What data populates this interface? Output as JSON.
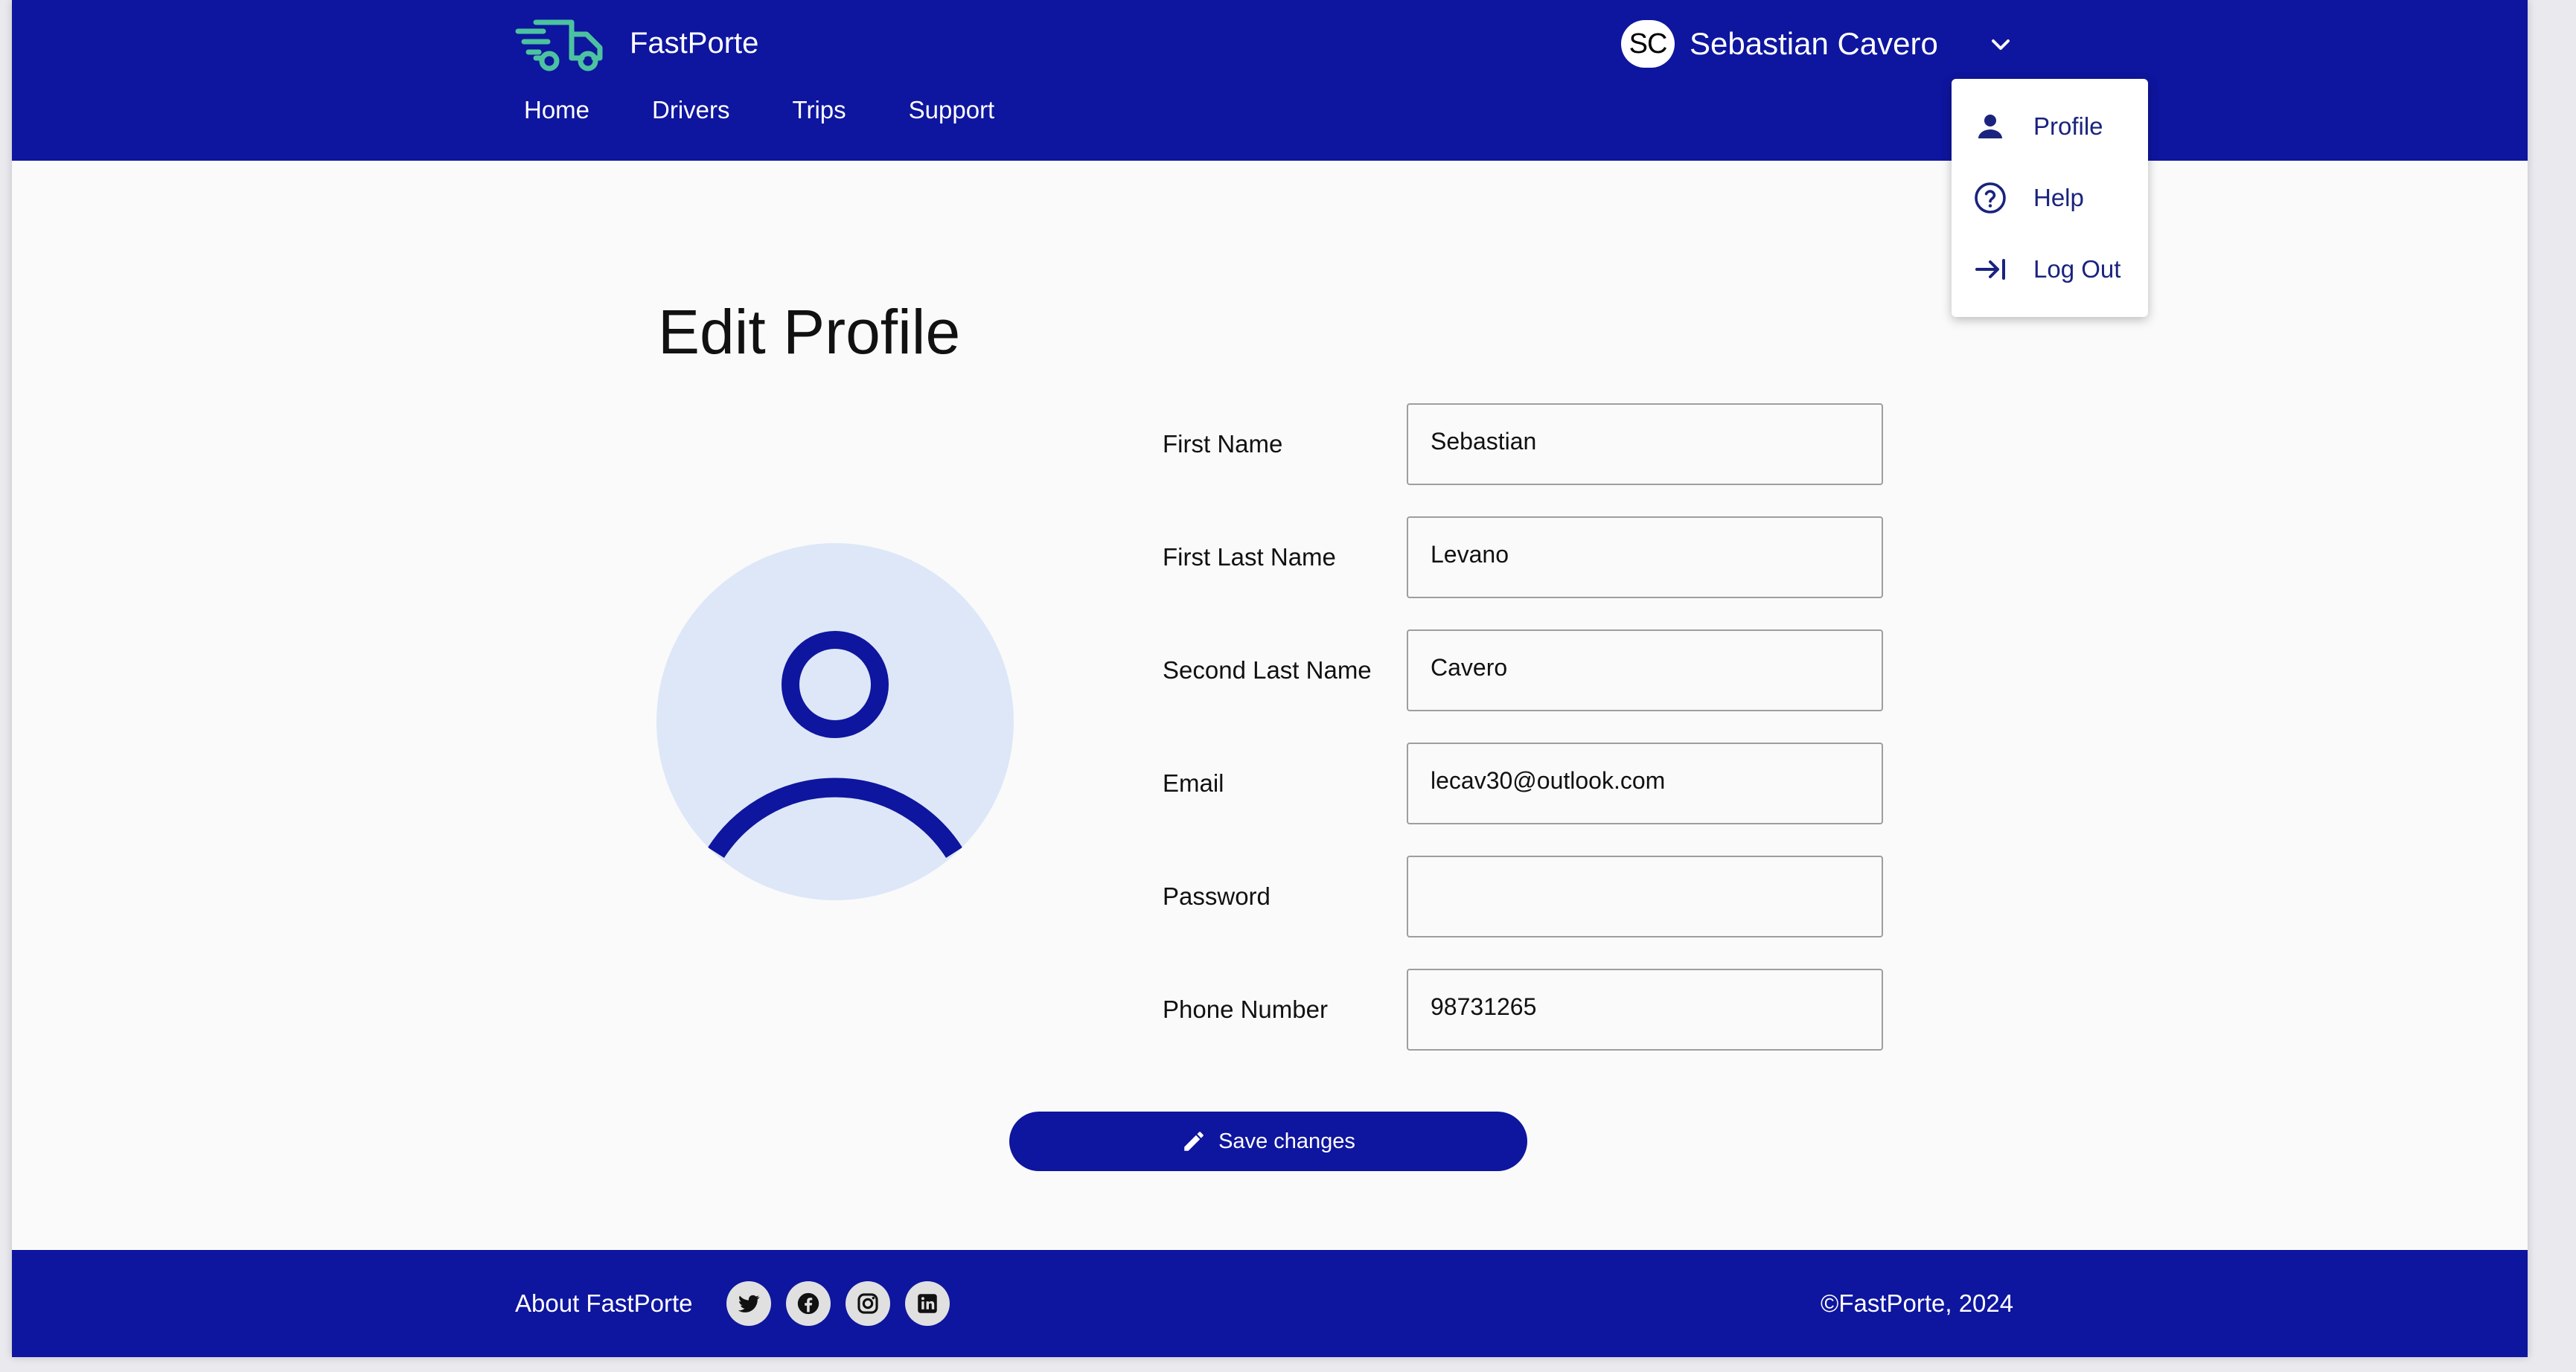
{
  "app": {
    "name": "FastPorte"
  },
  "colors": {
    "primary": "#0e159e",
    "logo_green": "#4cc2a0",
    "avatar_bg": "#dde7f8"
  },
  "header": {
    "nav": [
      {
        "label": "Home"
      },
      {
        "label": "Drivers"
      },
      {
        "label": "Trips"
      },
      {
        "label": "Support"
      }
    ],
    "user": {
      "initials": "SC",
      "name": "Sebastian Cavero"
    }
  },
  "user_menu": {
    "items": [
      {
        "label": "Profile",
        "icon": "person-icon"
      },
      {
        "label": "Help",
        "icon": "help-circle-icon"
      },
      {
        "label": "Log Out",
        "icon": "logout-arrow-icon"
      }
    ]
  },
  "main": {
    "title": "Edit Profile",
    "fields": [
      {
        "label": "First Name",
        "value": "Sebastian"
      },
      {
        "label": "First Last Name",
        "value": "Levano"
      },
      {
        "label": "Second Last Name",
        "value": "Cavero"
      },
      {
        "label": "Email",
        "value": "lecav30@outlook.com"
      },
      {
        "label": "Password",
        "value": ""
      },
      {
        "label": "Phone Number",
        "value": "98731265"
      }
    ],
    "save_label": "Save changes"
  },
  "footer": {
    "about": "About FastPorte",
    "social": [
      "twitter-icon",
      "facebook-icon",
      "instagram-icon",
      "linkedin-icon"
    ],
    "copyright": "©FastPorte, 2024"
  }
}
